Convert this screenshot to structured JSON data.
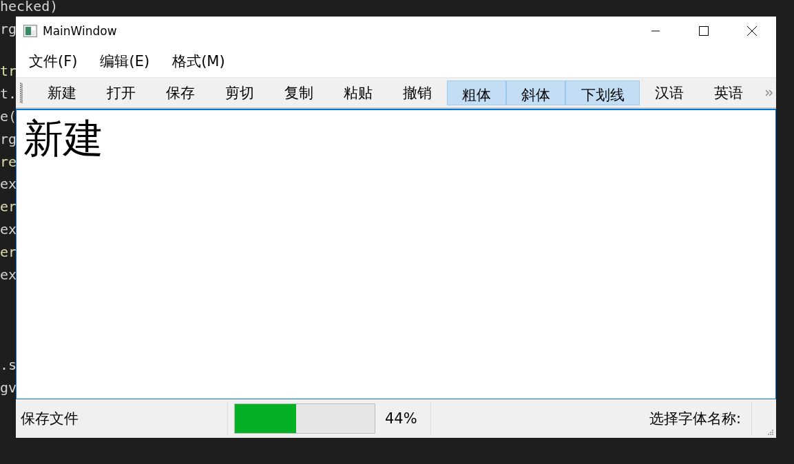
{
  "background_code": [
    [
      {
        "text": "hecked)",
        "color": "#d4d4d4"
      },
      {
        "text": "rg",
        "color": "#d4d4d4"
      }
    ],
    [
      {
        "text": "tr",
        "color": "#dcdcaa"
      },
      {
        "text": "t.",
        "color": "#d4d4d4"
      },
      {
        "text": "e(",
        "color": "#d4d4d4"
      },
      {
        "text": "rg",
        "color": "#d4d4d4"
      },
      {
        "text": "re",
        "color": "#dcdcaa"
      },
      {
        "text": "ex",
        "color": "#d4d4d4"
      },
      {
        "text": "er",
        "color": "#dcdcaa"
      },
      {
        "text": "ex",
        "color": "#d4d4d4"
      },
      {
        "text": "er",
        "color": "#dcdcaa"
      },
      {
        "text": "ex",
        "color": "#d4d4d4"
      }
    ],
    [
      {
        "text": ".s",
        "color": "#d4d4d4"
      },
      {
        "text": "gv",
        "color": "#d4d4d4"
      }
    ]
  ],
  "window": {
    "title": "MainWindow"
  },
  "menu": [
    "文件(F)",
    "编辑(E)",
    "格式(M)"
  ],
  "toolbar": [
    {
      "label": "新建",
      "checked": false
    },
    {
      "label": "打开",
      "checked": false
    },
    {
      "label": "保存",
      "checked": false
    },
    {
      "label": "剪切",
      "checked": false
    },
    {
      "label": "复制",
      "checked": false
    },
    {
      "label": "粘贴",
      "checked": false
    },
    {
      "label": "撤销",
      "checked": false
    },
    {
      "label": "粗体",
      "checked": true
    },
    {
      "label": "斜体",
      "checked": true
    },
    {
      "label": "下划线",
      "checked": true
    },
    {
      "label": "汉语",
      "checked": false
    },
    {
      "label": "英语",
      "checked": false
    }
  ],
  "editor": {
    "text": "新建"
  },
  "status_bar": {
    "message": "保存文件",
    "progress": {
      "level": 0.44,
      "reading": "44%"
    },
    "font_label": "选择字体名称:"
  }
}
